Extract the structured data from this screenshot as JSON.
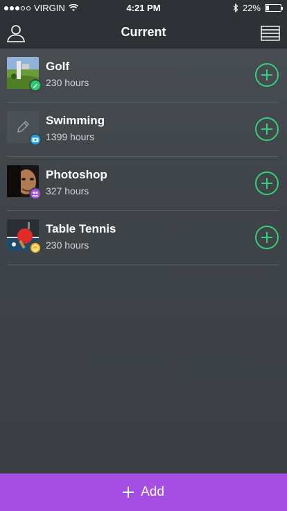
{
  "status_bar": {
    "carrier": "VIRGIN",
    "time": "4:21 PM",
    "battery_percent": "22%",
    "battery_level": 0.22,
    "signal_bars_filled": 3,
    "signal_bars_total": 5
  },
  "nav": {
    "title": "Current",
    "left_icon": "user-icon",
    "right_icon": "list-menu-icon"
  },
  "activities": [
    {
      "name": "Golf",
      "hours": "230 hours",
      "badge_icon": "pen-icon",
      "badge_color": "#2ecc71"
    },
    {
      "name": "Swimming",
      "hours": "1399 hours",
      "badge_icon": "camera-icon",
      "badge_color": "#1aa3e8"
    },
    {
      "name": "Photoshop",
      "hours": "327 hours",
      "badge_icon": "group-icon",
      "badge_color": "#a54ee3"
    },
    {
      "name": "Table Tennis",
      "hours": "230 hours",
      "badge_icon": "smile-icon",
      "badge_color": "#f2b81d"
    }
  ],
  "add_bar": {
    "label": "Add",
    "color": "#a54ee3"
  },
  "colors": {
    "accent_green": "#33d17a",
    "background": "#40454a"
  }
}
